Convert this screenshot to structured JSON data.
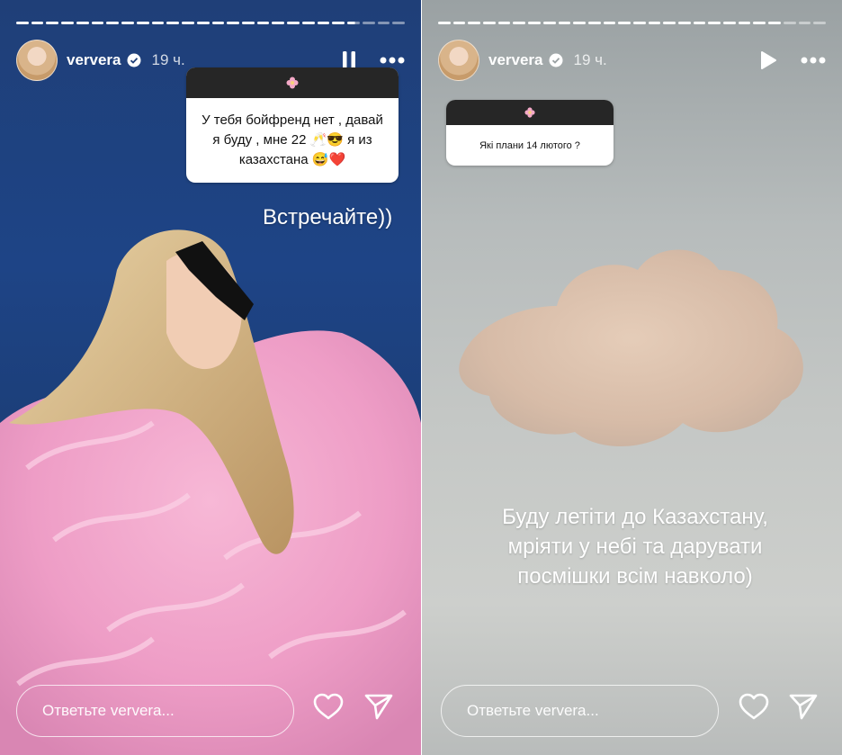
{
  "stories": [
    {
      "username": "ververa",
      "time": "19 ч.",
      "control": "pause",
      "question_icon": "flower-icon",
      "question_text": "У тебя бойфренд нет , давай я буду , мне 22 🥂😎 я из казахстана 😅❤️",
      "caption": "Встречайте))",
      "reply_placeholder": "Ответьте ververa..."
    },
    {
      "username": "ververa",
      "time": "19 ч.",
      "control": "play",
      "question_icon": "flower-icon",
      "question_text": "Які плани 14 лютого ?",
      "caption": "Буду летіти до Казахстану, мріяти у небі та дарувати посмішки всім навколо)",
      "reply_placeholder": "Ответьте ververa..."
    }
  ],
  "icons": [
    "verified-badge-icon",
    "pause-icon",
    "play-icon",
    "more-icon",
    "heart-icon",
    "send-icon",
    "flower-icon"
  ]
}
